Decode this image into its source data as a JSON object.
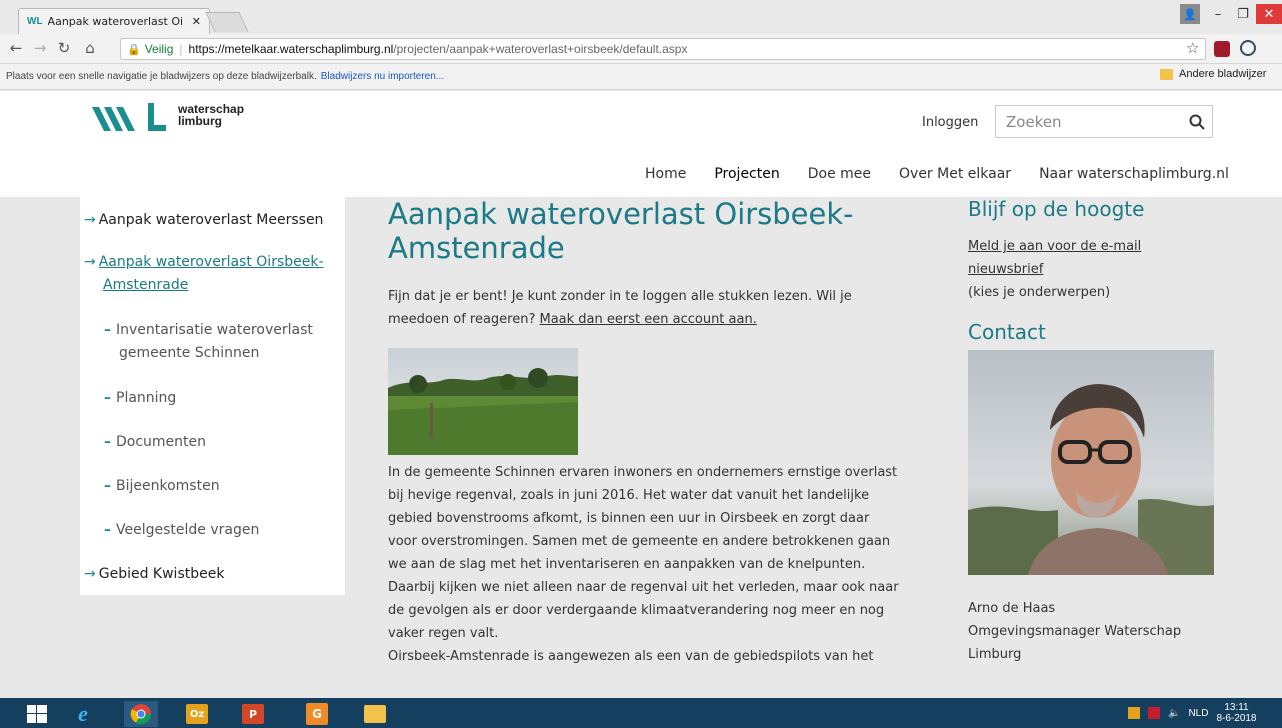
{
  "browser": {
    "tab_title": "Aanpak wateroverlast Oi",
    "tab_favicon": "WL",
    "secure_label": "Veilig",
    "url_host": "https://metelkaar.waterschaplimburg.nl",
    "url_path": "/projecten/aanpak+wateroverlast+oirsbeek/default.aspx",
    "bookmarks_hint": "Plaats voor een snelle navigatie je bladwijzers op deze bladwijzerbalk.",
    "bookmarks_import": "Bladwijzers nu importeren...",
    "other_bookmarks": "Andere bladwijzer"
  },
  "site": {
    "logo_text_1": "waterschap",
    "logo_text_2": "limburg",
    "login": "Inloggen",
    "search_placeholder": "Zoeken",
    "nav": [
      "Home",
      "Projecten",
      "Doe mee",
      "Over Met elkaar",
      "Naar waterschaplimburg.nl"
    ],
    "brand_color": "#1a7a85"
  },
  "sidebar": {
    "item1": "Aanpak wateroverlast Meerssen",
    "item2_l1": "Aanpak wateroverlast Oirsbeek-",
    "item2_l2": "Amstenrade",
    "sub1_l1": "Inventarisatie wateroverlast",
    "sub1_l2": "gemeente Schinnen",
    "sub2": "Planning",
    "sub3": "Documenten",
    "sub4": "Bijeenkomsten",
    "sub5": "Veelgestelde vragen",
    "item3": "Gebied Kwistbeek"
  },
  "content": {
    "title_l1": "Aanpak wateroverlast Oirsbeek-",
    "title_l2": "Amstenrade",
    "intro_l1": "Fijn dat je er bent! Je kunt zonder in te loggen alle stukken lezen. Wil je",
    "intro_l2": "meedoen of reageren? ",
    "intro_link": "Maak dan eerst een account aan.",
    "body": [
      "In de gemeente Schinnen ervaren inwoners en ondernemers ernstige overlast",
      "bij hevige regenval, zoals in juni 2016. Het water dat vanuit het landelijke",
      "gebied bovenstrooms afkomt, is binnen een uur in Oirsbeek en zorgt daar",
      "voor overstromingen. Samen met de gemeente en andere betrokkenen gaan",
      "we aan de slag met het inventariseren en aanpakken van de knelpunten.",
      "Daarbij kijken we niet alleen naar de regenval uit het verleden, maar ook naar",
      "de gevolgen als er door verdergaande klimaatverandering nog meer en nog",
      "vaker regen valt.",
      "Oirsbeek-Amstenrade is aangewezen als een van de gebiedspilots van het"
    ]
  },
  "right": {
    "heading1": "Blijf op de hoogte",
    "newsletter_l1": "Meld je aan voor de e-mail",
    "newsletter_l2": "nieuwsbrief",
    "topics": "(kies je onderwerpen)",
    "heading2": "Contact",
    "contact_name": "Arno de Haas",
    "contact_role_l1": "Omgevingsmanager Waterschap",
    "contact_role_l2": "Limburg"
  },
  "taskbar": {
    "lang": "NLD",
    "time": "13:11",
    "date": "8-6-2018"
  }
}
